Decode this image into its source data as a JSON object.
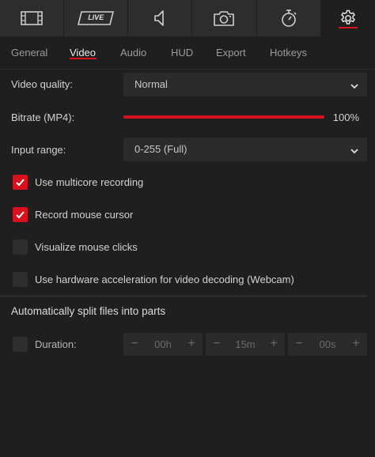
{
  "top_tabs": [
    {
      "name": "film",
      "icon": "film-icon"
    },
    {
      "name": "live",
      "icon": "live-icon",
      "label": "LIVE"
    },
    {
      "name": "audio",
      "icon": "speaker-icon"
    },
    {
      "name": "camera",
      "icon": "camera-icon"
    },
    {
      "name": "timer",
      "icon": "stopwatch-icon"
    },
    {
      "name": "settings",
      "icon": "gear-icon",
      "active": true
    }
  ],
  "sub_tabs": [
    "General",
    "Video",
    "Audio",
    "HUD",
    "Export",
    "Hotkeys"
  ],
  "active_sub_tab": "Video",
  "video_quality": {
    "label": "Video quality:",
    "value": "Normal"
  },
  "bitrate": {
    "label": "Bitrate (MP4):",
    "value": "100%",
    "level": 1.0
  },
  "input_range": {
    "label": "Input range:",
    "value": "0-255 (Full)"
  },
  "options": [
    {
      "label": "Use multicore recording",
      "checked": true
    },
    {
      "label": "Record mouse cursor",
      "checked": true
    },
    {
      "label": "Visualize mouse clicks",
      "checked": false
    },
    {
      "label": "Use hardware acceleration for video decoding (Webcam)",
      "checked": false
    }
  ],
  "split": {
    "title": "Automatically split files into parts",
    "duration_label": "Duration:",
    "duration_checked": false,
    "hours": "00h",
    "minutes": "15m",
    "seconds": "00s",
    "minus": "−",
    "plus": "+"
  },
  "colors": {
    "accent": "#d8111f",
    "background": "#1f1f1f",
    "control": "#2b2b2b"
  }
}
